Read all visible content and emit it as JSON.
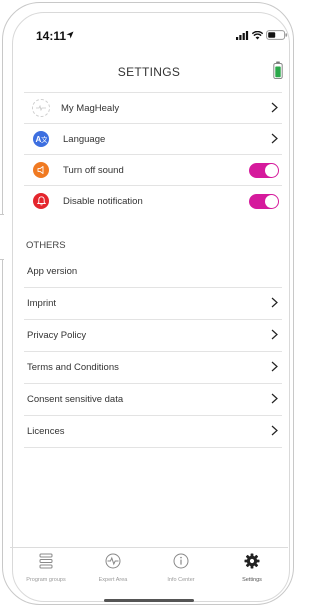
{
  "status": {
    "time": "14:11"
  },
  "header": {
    "title": "SETTINGS",
    "battery_icon": "battery-icon"
  },
  "settings_items": [
    {
      "label": "My MagHealy",
      "icon": "device-icon",
      "control": "chevron"
    },
    {
      "label": "Language",
      "icon": "language-icon",
      "color": "#3d6fe0",
      "control": "chevron"
    },
    {
      "label": "Turn off sound",
      "icon": "speaker-icon",
      "color": "#f07a22",
      "control": "toggle",
      "on": true
    },
    {
      "label": "Disable notification",
      "icon": "bell-icon",
      "color": "#e4262d",
      "control": "toggle",
      "on": true
    }
  ],
  "others": {
    "title": "OTHERS",
    "items": [
      {
        "label": "App version",
        "control": "none"
      },
      {
        "label": "Imprint",
        "control": "chevron"
      },
      {
        "label": "Privacy Policy",
        "control": "chevron"
      },
      {
        "label": "Terms and Conditions",
        "control": "chevron"
      },
      {
        "label": "Consent sensitive data",
        "control": "chevron"
      },
      {
        "label": "Licences",
        "control": "chevron"
      }
    ]
  },
  "tabbar": {
    "tabs": [
      {
        "label": "Program groups",
        "icon": "list-icon"
      },
      {
        "label": "Expert Area",
        "icon": "pulse-icon"
      },
      {
        "label": "Info Center",
        "icon": "info-icon"
      },
      {
        "label": "Settings",
        "icon": "gear-icon",
        "active": true
      }
    ]
  },
  "colors": {
    "toggle_on": "#d51a9c",
    "accent_battery": "#2aa84a"
  }
}
